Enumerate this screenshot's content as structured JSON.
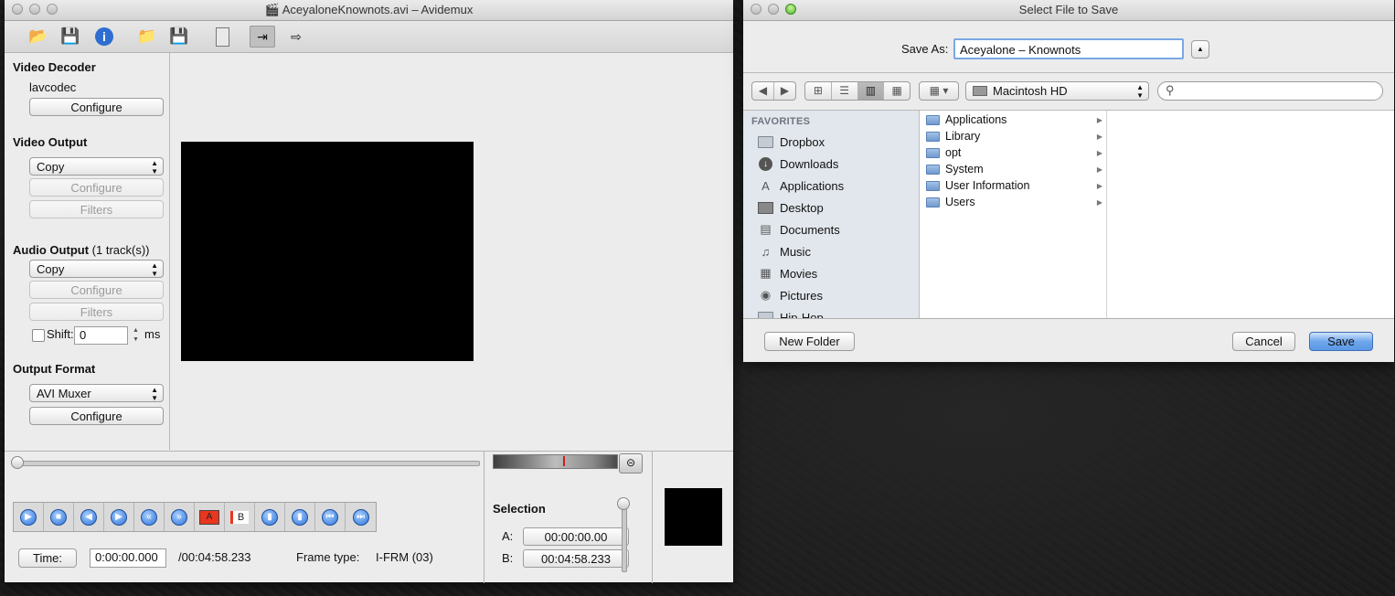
{
  "avidemux": {
    "title": "AceyaloneKnownots.avi – Avidemux",
    "toolbar_icons": [
      "open-icon",
      "save-icon",
      "info-icon",
      "open-folder-icon",
      "save-video-icon",
      "calculator-icon",
      "input-icon",
      "output-icon"
    ],
    "video_decoder": {
      "heading": "Video Decoder",
      "codec": "lavcodec",
      "configure": "Configure"
    },
    "video_output": {
      "heading": "Video Output",
      "selected": "Copy",
      "configure": "Configure",
      "filters": "Filters"
    },
    "audio_output": {
      "heading": "Audio Output",
      "tracks": "(1 track(s))",
      "selected": "Copy",
      "configure": "Configure",
      "filters": "Filters",
      "shift_label": "Shift:",
      "shift_value": "0",
      "ms": "ms"
    },
    "output_format": {
      "heading": "Output Format",
      "selected": "AVI Muxer",
      "configure": "Configure"
    },
    "controls": [
      "play",
      "stop",
      "prev-frame",
      "next-frame",
      "prev-keyframe",
      "next-keyframe",
      "set-marker-a",
      "set-marker-b",
      "prev-black",
      "next-black",
      "goto-first",
      "goto-last"
    ],
    "time_button": "Time:",
    "time_value": "0:00:00.000",
    "duration": "/00:04:58.233",
    "frame_type_label": "Frame type:",
    "frame_type_value": "I-FRM (03)",
    "selection": {
      "heading": "Selection",
      "a_label": "A:",
      "a_value": "00:00:00.00",
      "b_label": "B:",
      "b_value": "00:04:58.233"
    },
    "marker_a_text": "A",
    "marker_b_text": "B"
  },
  "dialog": {
    "title": "Select File to Save",
    "save_as_label": "Save As:",
    "filename": "Aceyalone – Knownots",
    "location": "Macintosh HD",
    "search_placeholder": "",
    "favorites_heading": "FAVORITES",
    "favorites": [
      {
        "label": "Dropbox",
        "icon": "folder-icon"
      },
      {
        "label": "Downloads",
        "icon": "downloads-icon"
      },
      {
        "label": "Applications",
        "icon": "applications-icon"
      },
      {
        "label": "Desktop",
        "icon": "desktop-icon"
      },
      {
        "label": "Documents",
        "icon": "documents-icon"
      },
      {
        "label": "Music",
        "icon": "music-icon"
      },
      {
        "label": "Movies",
        "icon": "movies-icon"
      },
      {
        "label": "Pictures",
        "icon": "pictures-icon"
      },
      {
        "label": "Hip-Hop",
        "icon": "folder-icon"
      }
    ],
    "column_items": [
      "Applications",
      "Library",
      "opt",
      "System",
      "User Information",
      "Users"
    ],
    "new_folder": "New Folder",
    "cancel": "Cancel",
    "save": "Save"
  }
}
